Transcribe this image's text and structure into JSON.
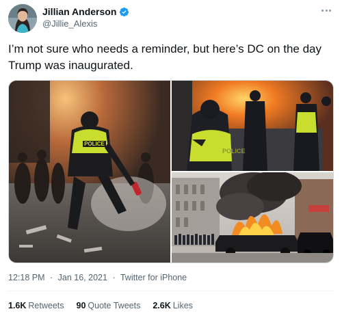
{
  "user": {
    "display_name": "Jillian Anderson",
    "handle": "@Jillie_Alexis",
    "verified": true
  },
  "icons": {
    "verified": "verified-badge-icon",
    "more": "more-dots-icon"
  },
  "colors": {
    "verified_blue": "#1d9bf0",
    "secondary_text": "#536471",
    "primary_text": "#0f1419"
  },
  "tweet": {
    "text": "I’m not sure who needs a reminder, but here’s DC on the day Trump was inaugurated.",
    "media": [
      {
        "label": "POLICE"
      },
      {
        "label": "POLICE"
      },
      {
        "label": ""
      }
    ]
  },
  "meta": {
    "time": "12:18 PM",
    "date": "Jan 16, 2021",
    "source": "Twitter for iPhone",
    "separator": "·"
  },
  "stats": {
    "retweets_count": "1.6K",
    "retweets_label": "Retweets",
    "quotes_count": "90",
    "quotes_label": "Quote Tweets",
    "likes_count": "2.6K",
    "likes_label": "Likes"
  }
}
